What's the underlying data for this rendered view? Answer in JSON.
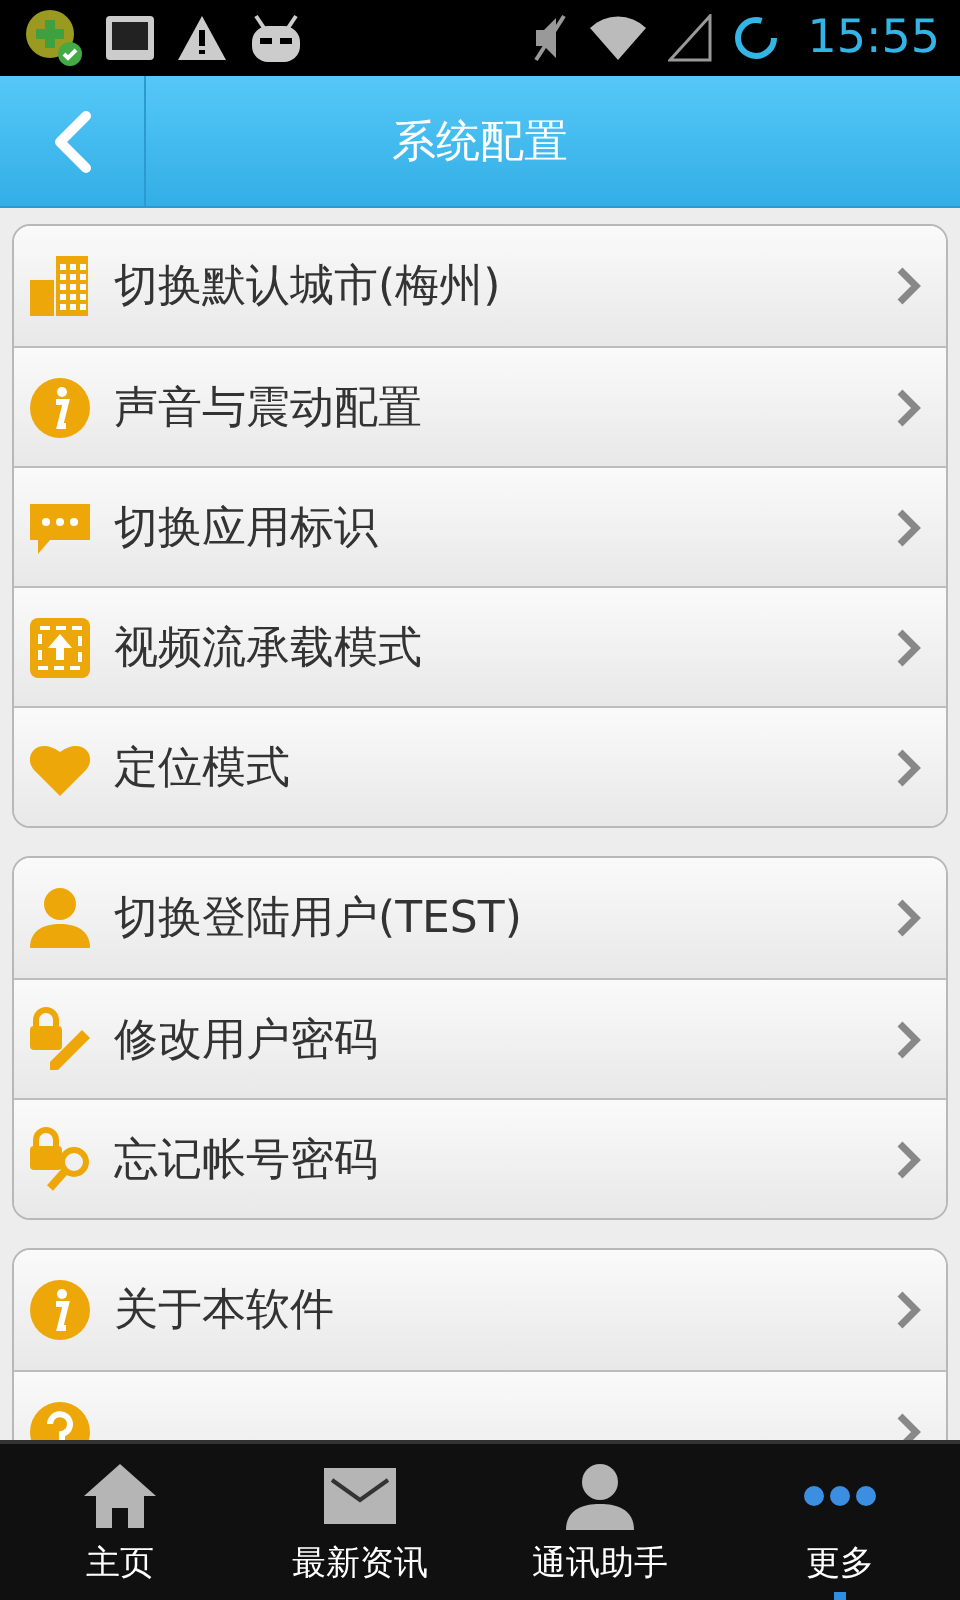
{
  "status_bar": {
    "time": "15:55"
  },
  "header": {
    "title": "系统配置"
  },
  "groups": [
    {
      "items": [
        {
          "kind": "buildings",
          "label": "切换默认城市(梅州)"
        },
        {
          "kind": "info",
          "label": "声音与震动配置"
        },
        {
          "kind": "chat",
          "label": "切换应用标识"
        },
        {
          "kind": "upload",
          "label": "视频流承载模式"
        },
        {
          "kind": "heart",
          "label": "定位模式"
        }
      ]
    },
    {
      "items": [
        {
          "kind": "user",
          "label": "切换登陆用户(TEST)"
        },
        {
          "kind": "lockpen",
          "label": "修改用户密码"
        },
        {
          "kind": "locksearch",
          "label": "忘记帐号密码"
        }
      ]
    },
    {
      "items": [
        {
          "kind": "info",
          "label": "关于本软件"
        },
        {
          "kind": "help"
        }
      ]
    }
  ],
  "tabs": [
    {
      "kind": "home",
      "label": "主页",
      "selected": false
    },
    {
      "kind": "mail",
      "label": "最新资讯",
      "selected": false
    },
    {
      "kind": "user",
      "label": "通讯助手",
      "selected": false
    },
    {
      "kind": "more",
      "label": "更多",
      "selected": true
    }
  ]
}
